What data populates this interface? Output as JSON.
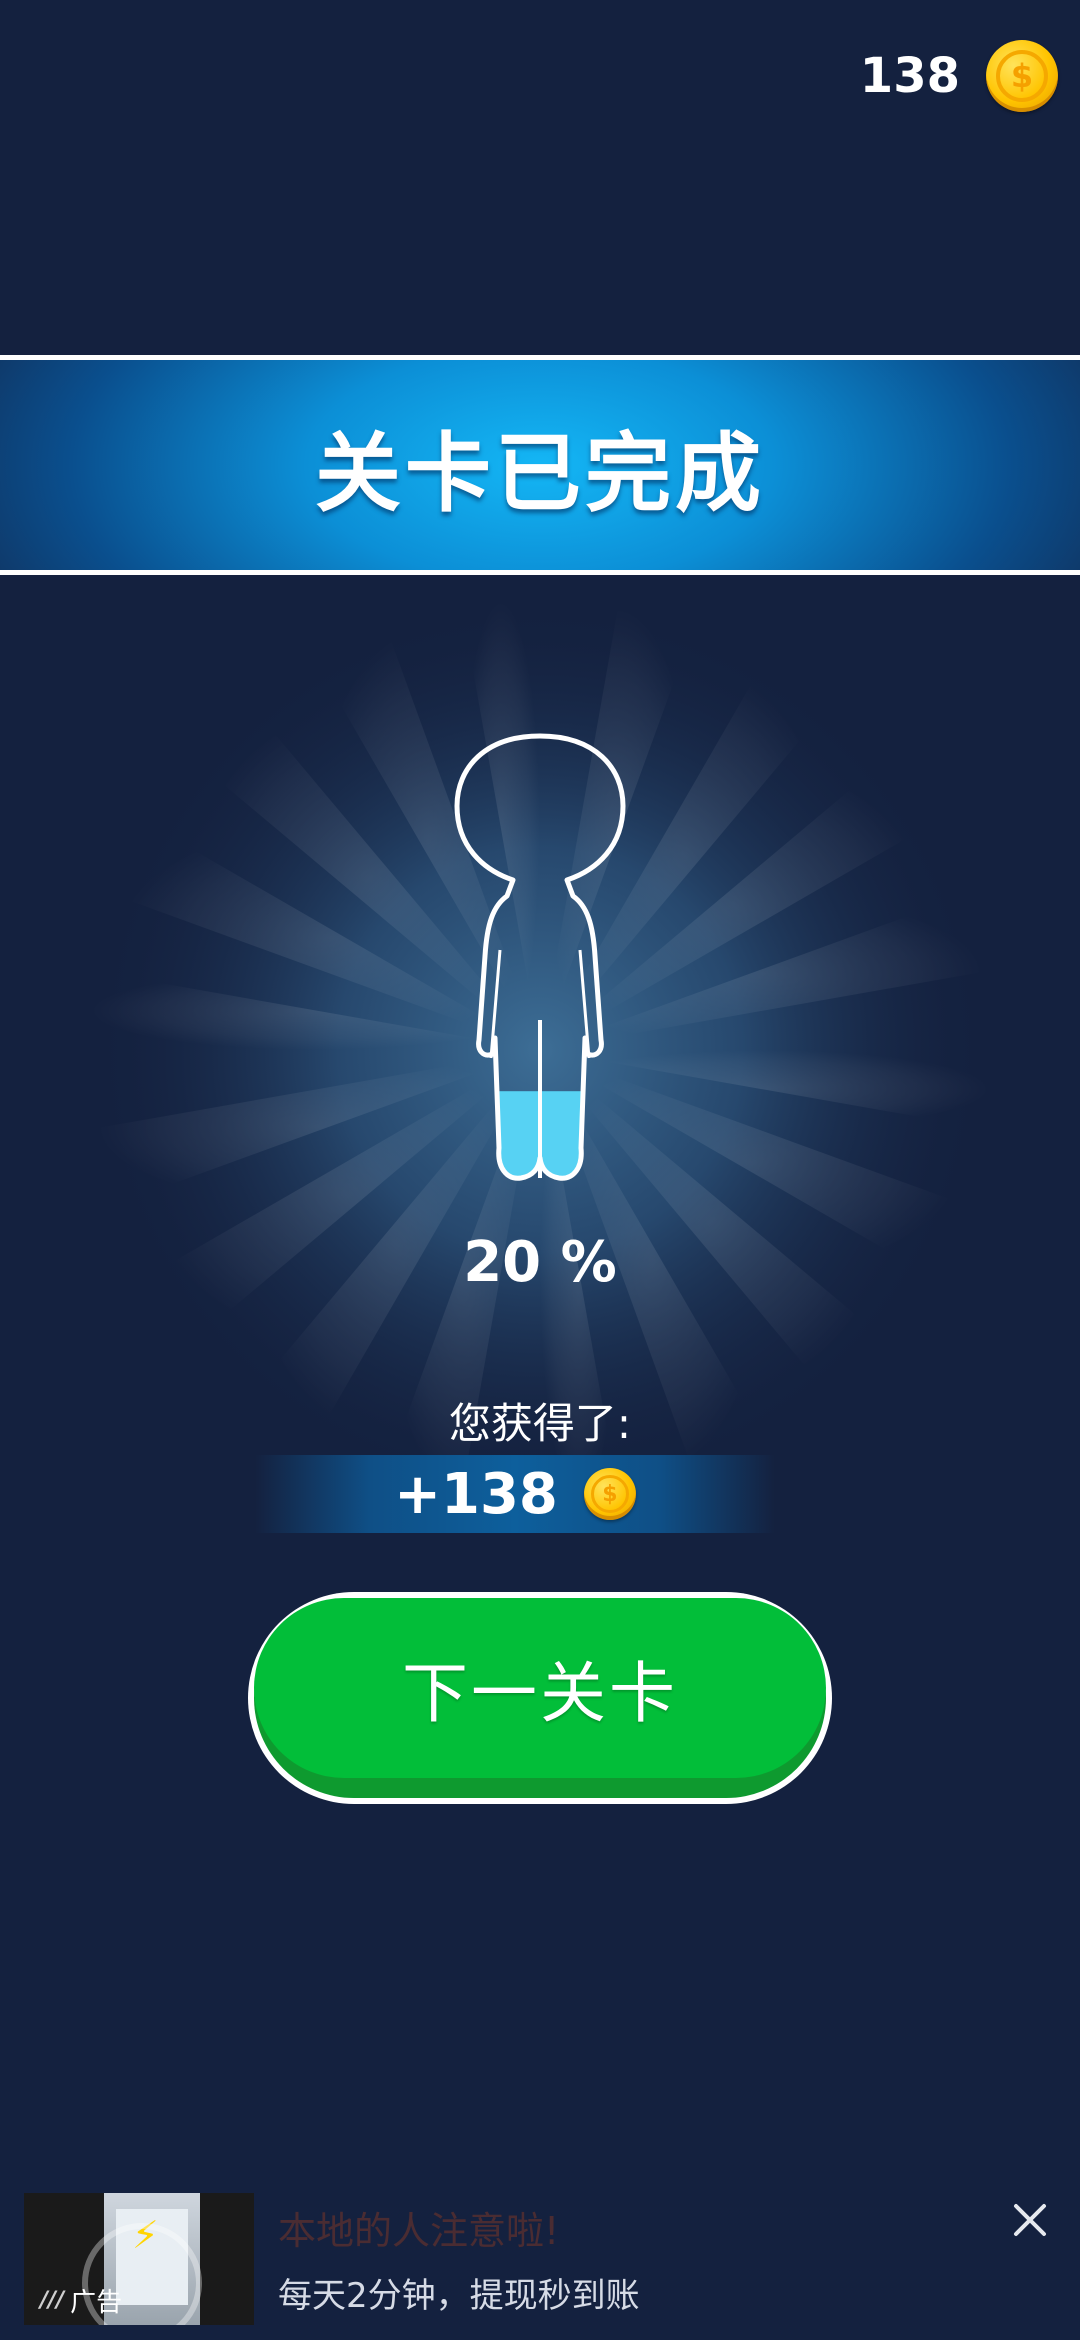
{
  "header": {
    "coin_count": "138",
    "coin_icon": "coin-icon",
    "coin_symbol": "$"
  },
  "banner": {
    "title": "关卡已完成"
  },
  "result": {
    "progress_percent": 20,
    "progress_label": "20 %",
    "fill_color": "#57d2f3"
  },
  "reward": {
    "label": "您获得了:",
    "amount": "+138",
    "coin_symbol": "$"
  },
  "actions": {
    "next_label": "下一关卡",
    "button_color": "#02be39"
  },
  "ad": {
    "badge": "广告",
    "title": "本地的人注意啦!",
    "subtitle": "每天2分钟，提现秒到账",
    "close_icon": "close-icon"
  },
  "theme": {
    "background": "#14213f",
    "banner_accent": "#14b6f5",
    "coin_gold": "#ffc400"
  }
}
